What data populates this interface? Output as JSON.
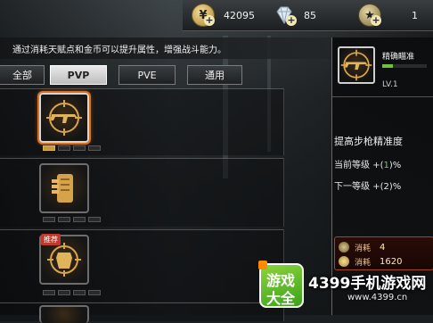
{
  "resources": {
    "gold": {
      "icon": "gold-coin-icon",
      "value": "42095"
    },
    "diamond": {
      "icon": "diamond-icon",
      "value": "85"
    },
    "rank": {
      "icon": "rank-badge-icon",
      "value": "1"
    }
  },
  "description": "通过消耗天赋点和金币可以提升属性，增强战斗能力。",
  "tabs": [
    {
      "label": "全部",
      "active": false
    },
    {
      "label": "PVP",
      "active": true
    },
    {
      "label": "PVE",
      "active": false
    },
    {
      "label": "通用",
      "active": false
    }
  ],
  "talents": [
    {
      "icon": "rifle-crosshair-icon",
      "selected": true,
      "level_pips": 4,
      "filled_pips": 1
    },
    {
      "icon": "ammo-magazine-icon",
      "selected": false,
      "level_pips": 4,
      "filled_pips": 0
    },
    {
      "icon": "armor-crosshair-icon",
      "selected": false,
      "level_pips": 4,
      "filled_pips": 0,
      "tag": "推荐"
    }
  ],
  "detail": {
    "name": "精确瞄准",
    "progress": 0.24,
    "level": "LV.1",
    "stat_title": "提高步枪精准度",
    "current_label": "当前等级",
    "current_prefix": "+(",
    "current_value": "1",
    "current_suffix": ")%",
    "next_label": "下一等级",
    "next_value": "+(2)%",
    "costs": [
      {
        "icon": "talent-point-icon",
        "label": "消耗",
        "value": "4"
      },
      {
        "icon": "gold-coin-icon",
        "label": "消耗",
        "value": "1620"
      }
    ]
  },
  "watermark": {
    "logo_top": "游戏",
    "logo_bottom": "大全",
    "text": "4399手机游戏网",
    "url": "www.4399.cn"
  },
  "colors": {
    "accent_orange": "#e06f1a",
    "highlight_green": "#6ed13d",
    "gold": "#c99a3a"
  }
}
